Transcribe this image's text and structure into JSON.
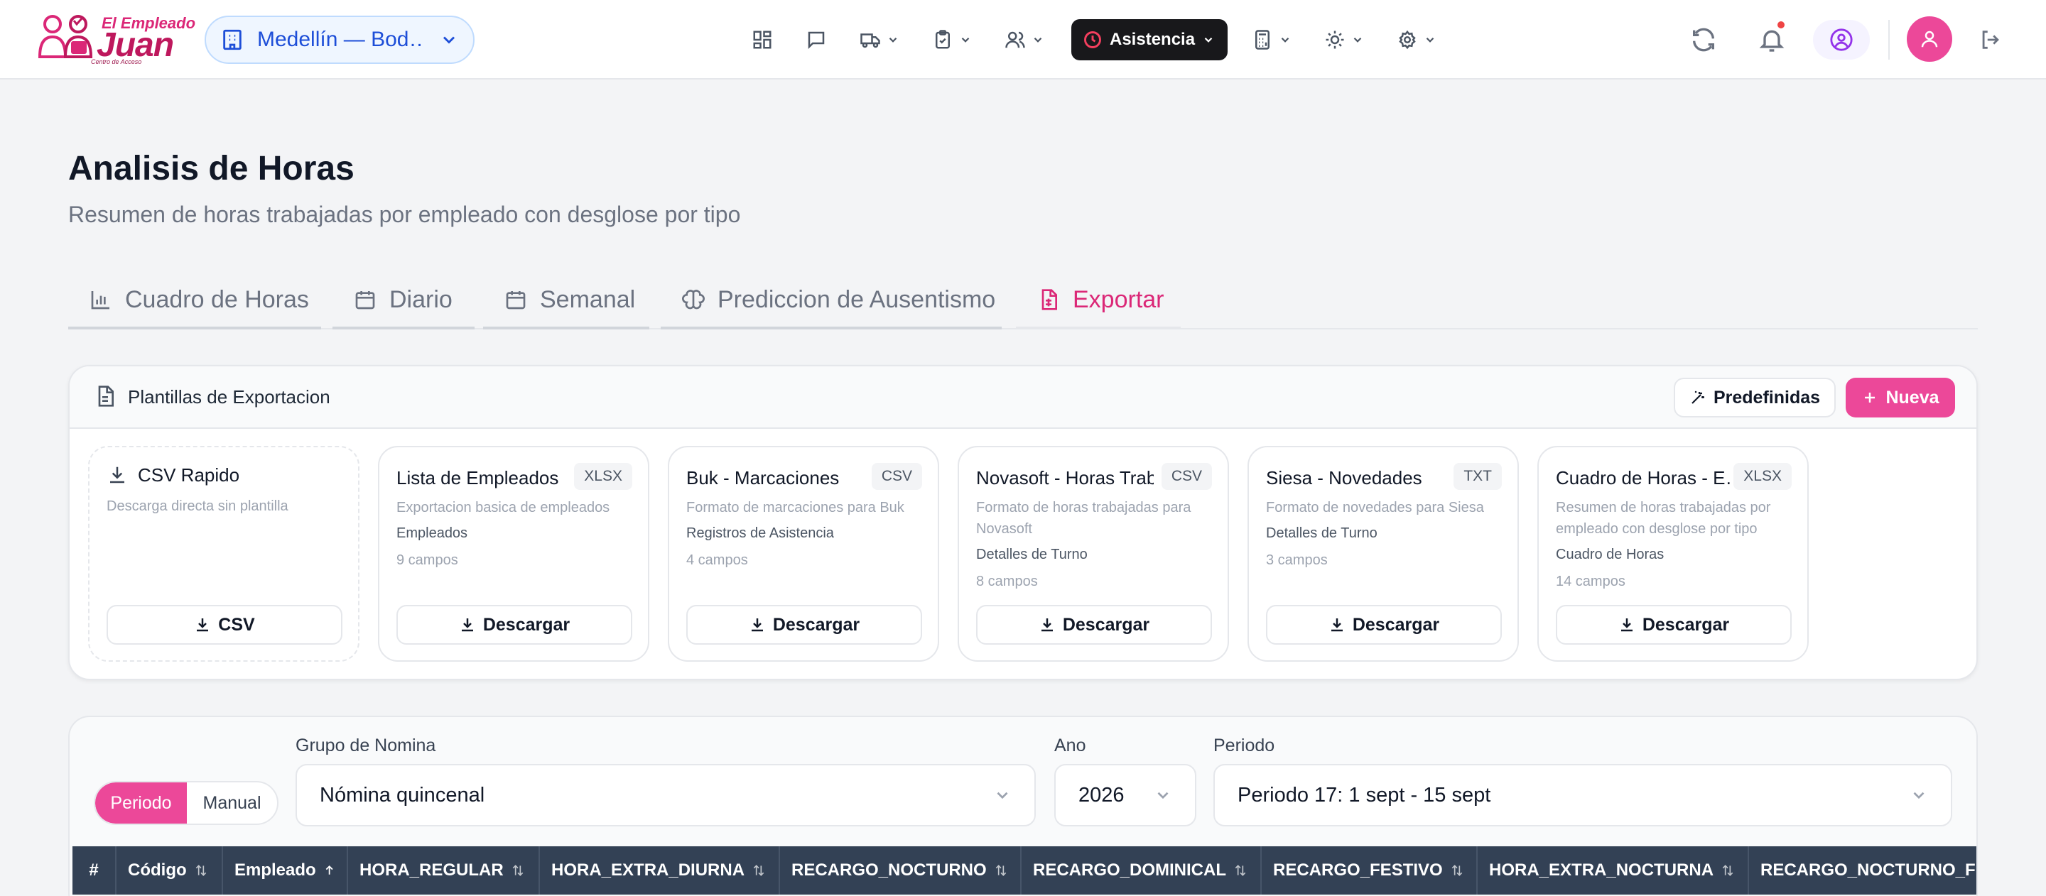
{
  "brand": {
    "line1": "El Empleado",
    "line2": "Juan",
    "tagline": "Centro de Acceso"
  },
  "location": {
    "label": "Medellín — Bod…"
  },
  "nav": {
    "items": [
      {
        "icon": "dashboard-icon",
        "dropdown": false
      },
      {
        "icon": "chat-icon",
        "dropdown": false
      },
      {
        "icon": "truck-icon",
        "dropdown": true
      },
      {
        "icon": "clipboard-icon",
        "dropdown": true
      },
      {
        "icon": "users-icon",
        "dropdown": true
      },
      {
        "icon": "clock-icon",
        "dropdown": true,
        "label": "Asistencia",
        "active": true
      },
      {
        "icon": "calculator-icon",
        "dropdown": true
      },
      {
        "icon": "cog-icon",
        "dropdown": true
      },
      {
        "icon": "settings-icon",
        "dropdown": true
      }
    ],
    "active_label": "Asistencia"
  },
  "page": {
    "title": "Analisis de Horas",
    "subtitle": "Resumen de horas trabajadas por empleado con desglose por tipo"
  },
  "tabs": [
    {
      "label": "Cuadro de Horas",
      "icon": "bar-chart-icon"
    },
    {
      "label": "Diario",
      "icon": "calendar-icon"
    },
    {
      "label": "Semanal",
      "icon": "calendar-icon"
    },
    {
      "label": "Prediccion de Ausentismo",
      "icon": "brain-icon"
    },
    {
      "label": "Exportar",
      "icon": "file-spreadsheet-icon",
      "active": true
    }
  ],
  "export_card": {
    "title": "Plantillas de Exportacion",
    "predefined_label": "Predefinidas",
    "new_label": "Nueva",
    "quick": {
      "name": "CSV Rapido",
      "desc": "Descarga directa sin plantilla",
      "button": "CSV"
    },
    "templates": [
      {
        "name": "Lista de Empleados",
        "format": "XLSX",
        "desc": "Exportacion basica de empleados",
        "source": "Empleados",
        "fields": "9 campos",
        "button": "Descargar"
      },
      {
        "name": "Buk - Marcaciones",
        "format": "CSV",
        "desc": "Formato de marcaciones para Buk",
        "source": "Registros de Asistencia",
        "fields": "4 campos",
        "button": "Descargar"
      },
      {
        "name": "Novasoft - Horas Trab…",
        "format": "CSV",
        "desc": "Formato de horas trabajadas para Novasoft",
        "source": "Detalles de Turno",
        "fields": "8 campos",
        "button": "Descargar"
      },
      {
        "name": "Siesa - Novedades",
        "format": "TXT",
        "desc": "Formato de novedades para Siesa",
        "source": "Detalles de Turno",
        "fields": "3 campos",
        "button": "Descargar"
      },
      {
        "name": "Cuadro de Horas - E…",
        "format": "XLSX",
        "desc": "Resumen de horas trabajadas por empleado con desglose por tipo",
        "source": "Cuadro de Horas",
        "fields": "14 campos",
        "button": "Descargar"
      }
    ]
  },
  "filters": {
    "mode": {
      "periodo": "Periodo",
      "manual": "Manual"
    },
    "group_label": "Grupo de Nomina",
    "group_value": "Nómina quincenal",
    "year_label": "Ano",
    "year_value": "2026",
    "period_label": "Periodo",
    "period_value": "Periodo 17: 1 sept - 15 sept"
  },
  "table": {
    "columns": [
      "#",
      "Código",
      "Empleado",
      "HORA_REGULAR",
      "HORA_EXTRA_DIURNA",
      "RECARGO_NOCTURNO",
      "RECARGO_DOMINICAL",
      "RECARGO_FESTIVO",
      "HORA_EXTRA_NOCTURNA",
      "RECARGO_NOCTURNO_F"
    ]
  },
  "colors": {
    "accent": "#ec4899",
    "accent_text": "#db2777",
    "nav_active_bg": "#18181b",
    "table_header_bg": "#334155",
    "location_text": "#1d4ed8"
  }
}
